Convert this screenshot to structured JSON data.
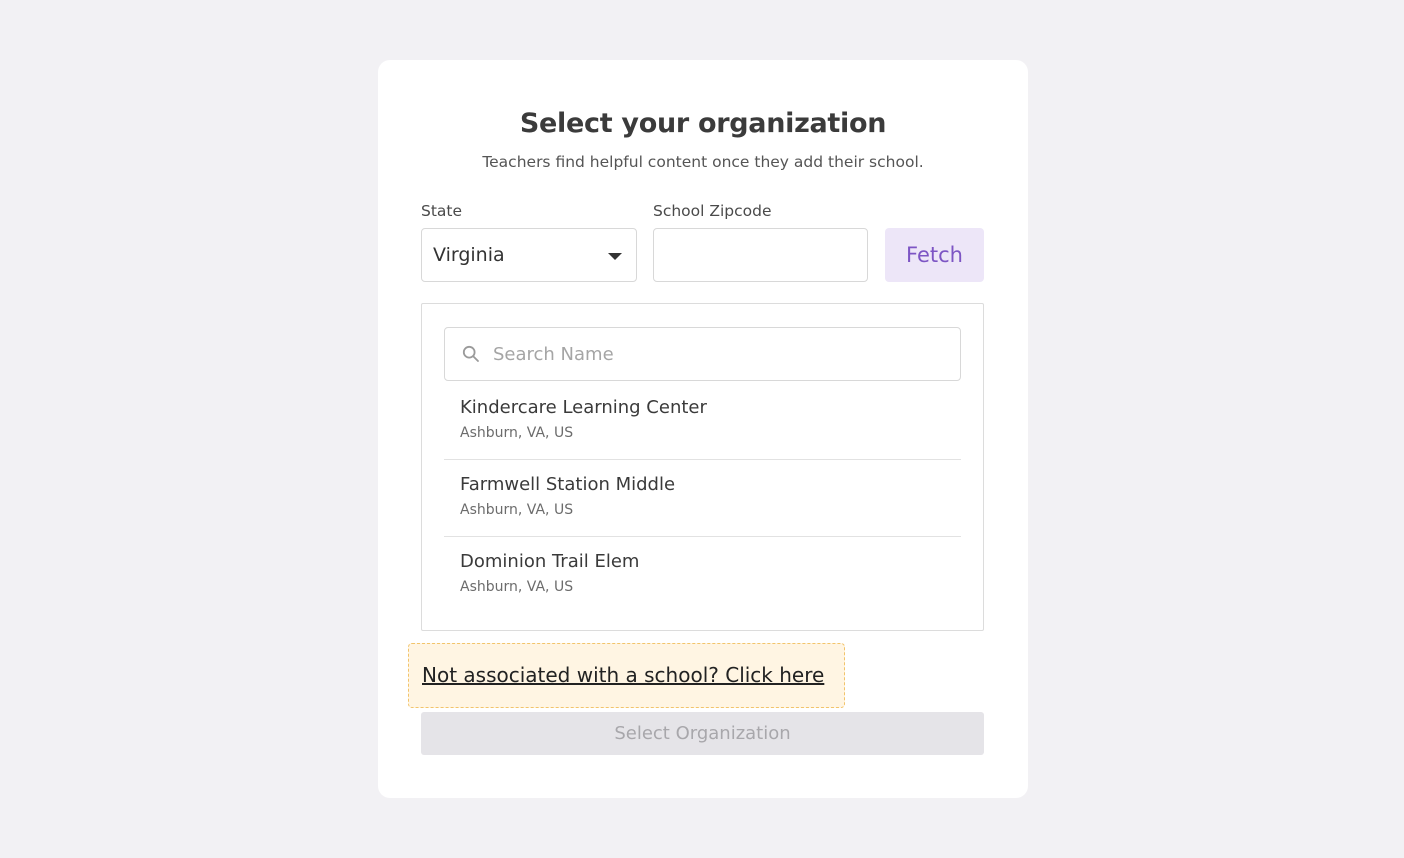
{
  "header": {
    "title": "Select your organization",
    "subtitle": "Teachers find helpful content once they add their school."
  },
  "form": {
    "state_label": "State",
    "state_value": "Virginia",
    "zip_label": "School Zipcode",
    "zip_value": "",
    "fetch_label": "Fetch"
  },
  "search": {
    "placeholder": "Search Name",
    "value": ""
  },
  "schools": [
    {
      "name": "Kindercare Learning Center",
      "location": "Ashburn, VA, US"
    },
    {
      "name": "Farmwell Station Middle",
      "location": "Ashburn, VA, US"
    },
    {
      "name": "Dominion Trail Elem",
      "location": "Ashburn, VA, US"
    }
  ],
  "no_school_link": "Not associated with a school? Click here",
  "select_button_label": "Select Organization",
  "icons": {
    "search": "search-icon",
    "dropdown": "caret-down-icon"
  },
  "colors": {
    "accent": "#7d55c4",
    "accent_bg": "#ede6f8",
    "highlight_bg": "#fff5e3",
    "highlight_border": "#f2c46b"
  }
}
